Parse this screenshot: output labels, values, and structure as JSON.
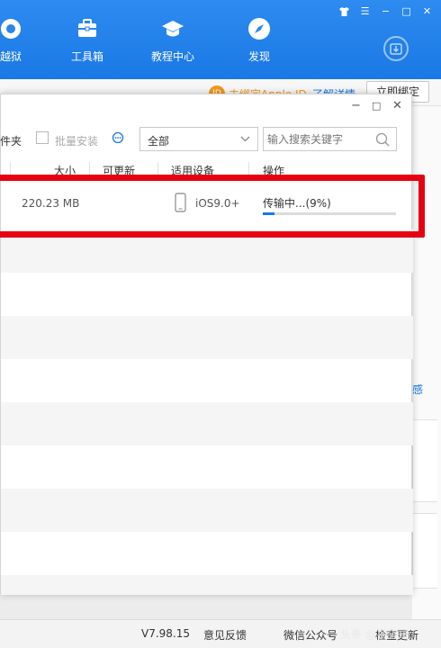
{
  "nav": {
    "items": [
      {
        "label": "越狱",
        "icon": "jailbreak-icon"
      },
      {
        "label": "工具箱",
        "icon": "toolbox-icon"
      },
      {
        "label": "教程中心",
        "icon": "graduation-cap-icon"
      },
      {
        "label": "发现",
        "icon": "compass-icon"
      }
    ]
  },
  "window_controls": {
    "skin": "shirt-icon",
    "menu": "☰",
    "minimize": "−",
    "maximize": "□",
    "close": "✕"
  },
  "background_page": {
    "appleid_icon": "ID",
    "appleid_text": "未绑定Apple ID",
    "appleid_link": "了解详情",
    "bind_button": "立即绑定",
    "side_glyph": "感"
  },
  "dialog": {
    "toolbar": {
      "folder_label": "件夹",
      "batch_install_label": "批量安装",
      "filter_select_value": "全部",
      "search_placeholder": "输入搜索关键字"
    },
    "columns": {
      "size": "大小",
      "updatable": "可更新",
      "device": "适用设备",
      "action": "操作"
    },
    "rows": [
      {
        "size": "220.23 MB",
        "device_req": "iOS9.0+",
        "status": "传输中...(9%)",
        "progress": 0.09
      }
    ]
  },
  "statusbar": {
    "version": "V7.98.15",
    "feedback": "意见反馈",
    "wechat": "微信公众号",
    "check_update": "检查更新",
    "watermark": "头条 @平头哥"
  },
  "colors": {
    "header_blue": "#1a78e6",
    "highlight_red": "#e60012",
    "warning_orange": "#f29b1e"
  }
}
